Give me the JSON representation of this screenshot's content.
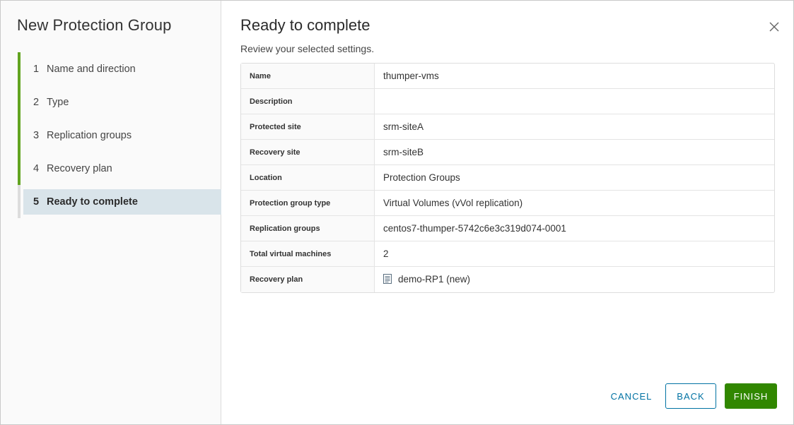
{
  "wizard": {
    "title": "New Protection Group",
    "steps": [
      {
        "num": "1",
        "label": "Name and direction"
      },
      {
        "num": "2",
        "label": "Type"
      },
      {
        "num": "3",
        "label": "Replication groups"
      },
      {
        "num": "4",
        "label": "Recovery plan"
      },
      {
        "num": "5",
        "label": "Ready to complete"
      }
    ],
    "active_step": "5"
  },
  "main": {
    "title": "Ready to complete",
    "subtitle": "Review your selected settings.",
    "summary": [
      {
        "key": "Name",
        "value": "thumper-vms"
      },
      {
        "key": "Description",
        "value": ""
      },
      {
        "key": "Protected site",
        "value": "srm-siteA"
      },
      {
        "key": "Recovery site",
        "value": "srm-siteB"
      },
      {
        "key": "Location",
        "value": "Protection Groups"
      },
      {
        "key": "Protection group type",
        "value": "Virtual Volumes (vVol replication)"
      },
      {
        "key": "Replication groups",
        "value": "centos7-thumper-5742c6e3c319d074-0001"
      },
      {
        "key": "Total virtual machines",
        "value": "2"
      },
      {
        "key": "Recovery plan",
        "value": "demo-RP1 (new)",
        "icon": "recovery-plan-icon"
      }
    ]
  },
  "footer": {
    "cancel_label": "CANCEL",
    "back_label": "BACK",
    "finish_label": "FINISH"
  },
  "colors": {
    "accent": "#0072a3",
    "success": "#318700",
    "step_complete": "#62a420",
    "active_step_bg": "#d9e4ea"
  }
}
